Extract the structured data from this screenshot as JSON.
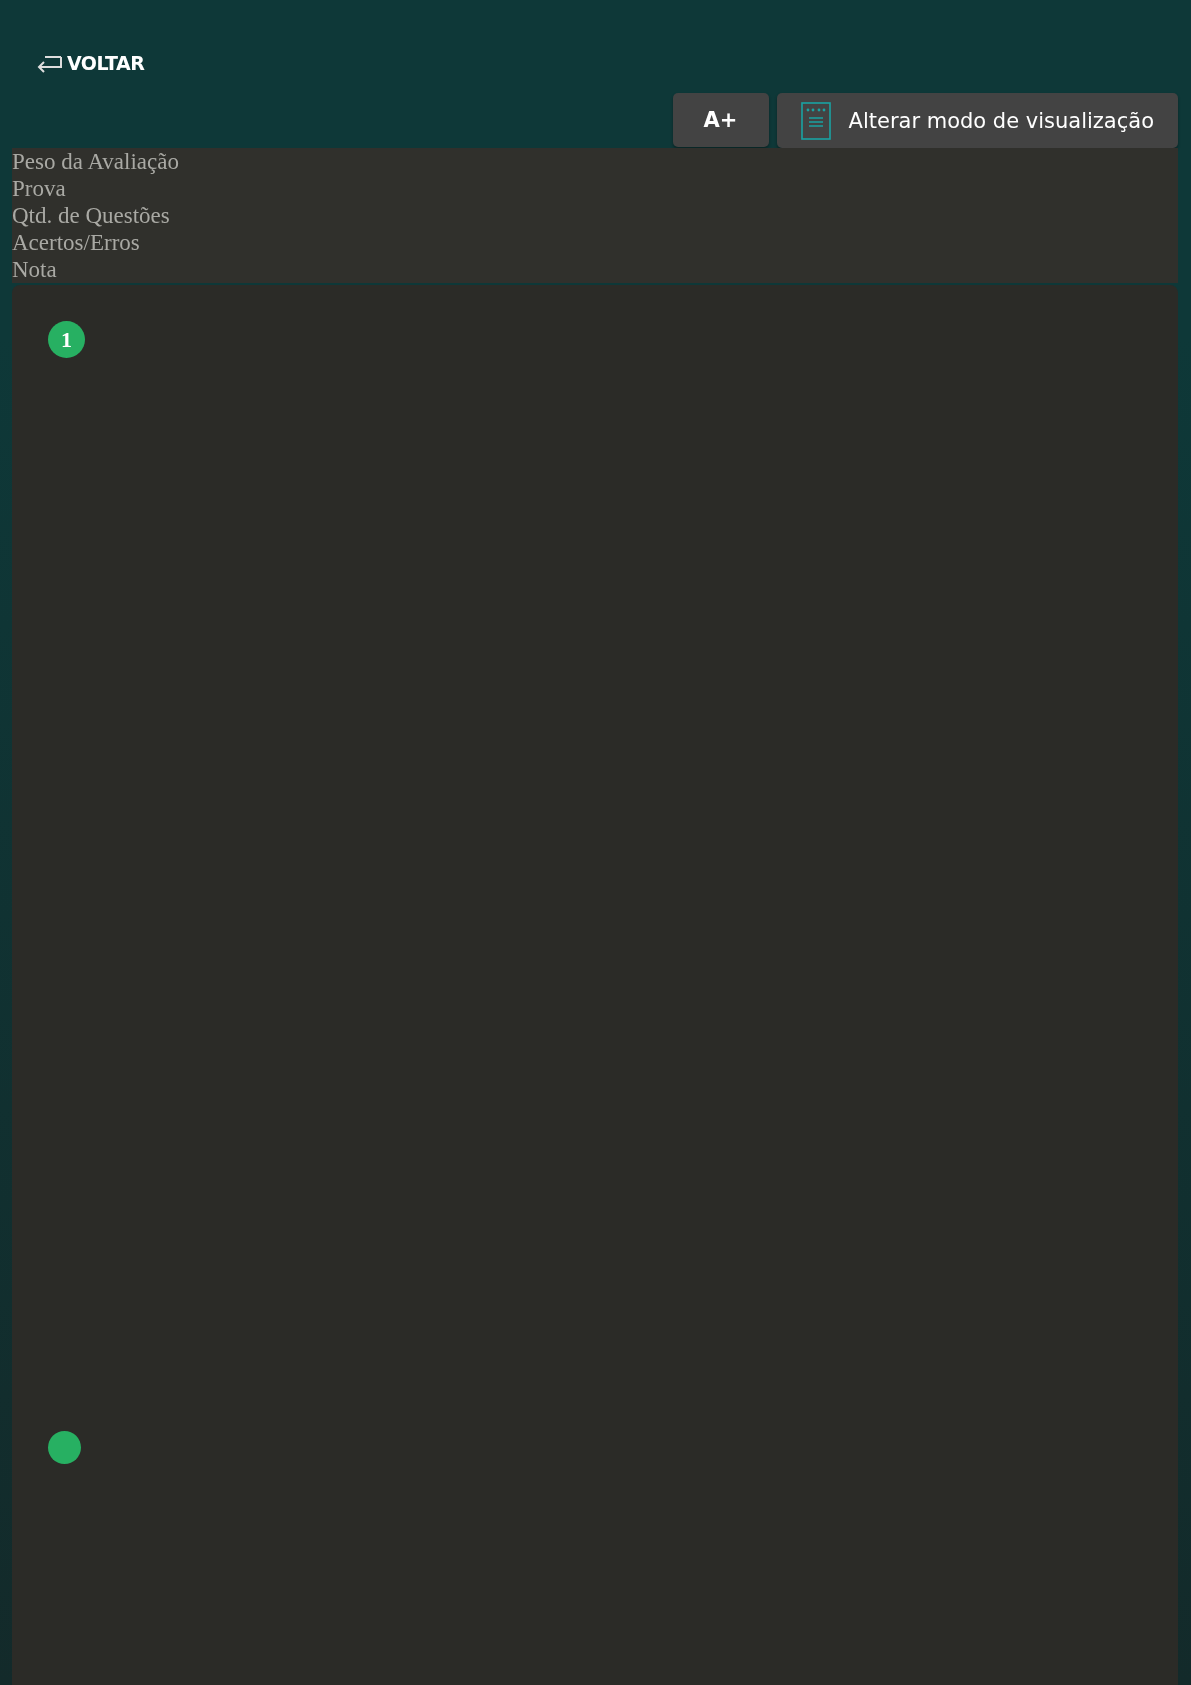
{
  "back_link": {
    "label": "VOLTAR"
  },
  "toolbar": {
    "buttons": [
      {
        "kind": "font",
        "label": "A+"
      },
      {
        "kind": "view",
        "label": "Alterar modo de visualização"
      }
    ]
  },
  "summary": {
    "labels": [
      "Peso da Avaliação",
      "Prova",
      "Qtd. de Questões",
      "Acertos/Erros",
      "Nota"
    ]
  },
  "markers": [
    {
      "kind": "numbered",
      "number": "1"
    },
    {
      "kind": "dot"
    }
  ]
}
